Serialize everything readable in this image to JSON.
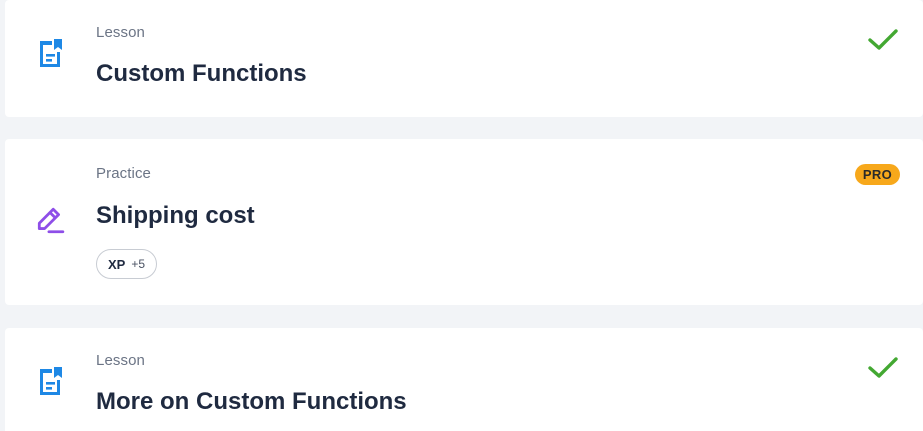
{
  "items": [
    {
      "kind": "Lesson",
      "title": "Custom Functions",
      "icon": "lesson-document-icon",
      "status": "completed",
      "status_icon": "checkmark-icon"
    },
    {
      "kind": "Practice",
      "title": "Shipping cost",
      "icon": "practice-pencil-icon",
      "badge": "PRO",
      "xp_label": "XP",
      "xp_value": "+5"
    },
    {
      "kind": "Lesson",
      "title": "More on Custom Functions",
      "icon": "lesson-document-icon",
      "status": "completed",
      "status_icon": "checkmark-icon"
    }
  ],
  "colors": {
    "background": "#f2f4f7",
    "card": "#ffffff",
    "lesson_icon": "#1e88e5",
    "practice_icon": "#8e4ee8",
    "check": "#43a832",
    "pro_badge": "#f7a81b",
    "title_text": "#1f2a40",
    "kind_text": "#6b7485"
  }
}
